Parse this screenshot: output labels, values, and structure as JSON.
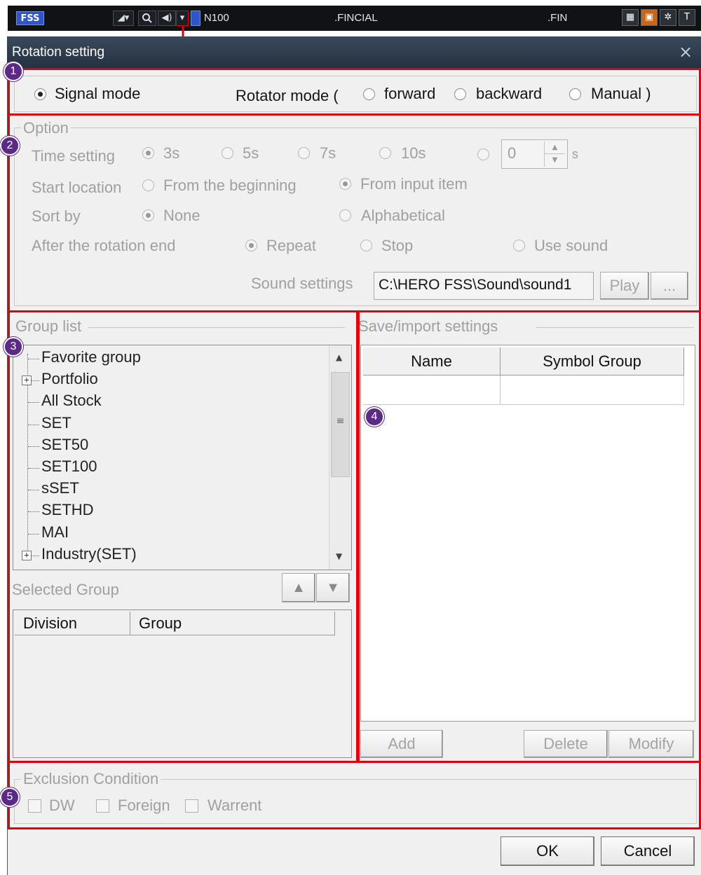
{
  "toolbar": {
    "logo": "FSS",
    "symbol_code": "N100",
    "field_1": ".FINCIAL",
    "field_2": ".FIN",
    "right_icon_last": "T"
  },
  "dialog": {
    "title": "Rotation setting",
    "close_glyph": "×"
  },
  "badges": [
    "1",
    "2",
    "3",
    "4",
    "5"
  ],
  "mode": {
    "signal_mode": "Signal mode",
    "rotator_mode_prefix": "Rotator mode (",
    "forward": "forward",
    "backward": "backward",
    "manual": "Manual )",
    "selected": "signal_mode"
  },
  "option": {
    "title": "Option",
    "time_setting_label": "Time setting",
    "time_choices": [
      "3s",
      "5s",
      "7s",
      "10s"
    ],
    "time_selected": "3s",
    "custom_value": "0",
    "custom_unit": "s",
    "start_location_label": "Start location",
    "start_from_beginning": "From the beginning",
    "start_from_input": "From input item",
    "start_selected": "From input item",
    "sort_by_label": "Sort by",
    "sort_none": "None",
    "sort_alpha": "Alphabetical",
    "sort_selected": "None",
    "after_end_label": "After the rotation end",
    "after_repeat": "Repeat",
    "after_stop": "Stop",
    "use_sound": "Use sound",
    "after_selected": "Repeat",
    "sound_settings_label": "Sound settings",
    "sound_path": "C:\\HERO FSS\\Sound\\sound1",
    "play_label": "Play",
    "browse_label": "..."
  },
  "group_list": {
    "title": "Group list",
    "items": [
      {
        "label": "Favorite group",
        "expandable": false
      },
      {
        "label": "Portfolio",
        "expandable": true
      },
      {
        "label": "All Stock",
        "expandable": false
      },
      {
        "label": "SET",
        "expandable": false
      },
      {
        "label": "SET50",
        "expandable": false
      },
      {
        "label": "SET100",
        "expandable": false
      },
      {
        "label": "sSET",
        "expandable": false
      },
      {
        "label": "SETHD",
        "expandable": false
      },
      {
        "label": "MAI",
        "expandable": false
      },
      {
        "label": "Industry(SET)",
        "expandable": true
      }
    ],
    "selected_group_label": "Selected Group",
    "columns": [
      "Division",
      "Group"
    ]
  },
  "save_import": {
    "title": "Save/import settings",
    "columns": [
      "Name",
      "Symbol Group"
    ],
    "add_label": "Add",
    "delete_label": "Delete",
    "modify_label": "Modify"
  },
  "exclusion": {
    "title": "Exclusion Condition",
    "options": [
      "DW",
      "Foreign",
      "Warrent"
    ]
  },
  "footer": {
    "ok_label": "OK",
    "cancel_label": "Cancel"
  },
  "colors": {
    "highlight_red": "#e00010",
    "badge_purple": "#5b2a86",
    "titlebar": "#2c3a4c",
    "logo_blue": "#2f56c6"
  }
}
